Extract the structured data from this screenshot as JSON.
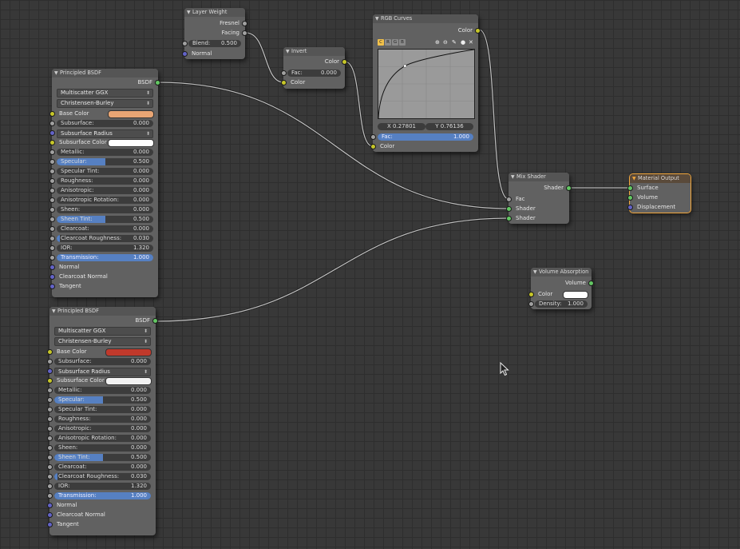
{
  "colors": {
    "shader_socket": "#63c763",
    "color_socket": "#c7c729",
    "value_socket": "#a1a1a1",
    "vector_socket": "#6363c7",
    "slider_fill": "#5680c2",
    "active_outline": "#f2a73d"
  },
  "layer_weight": {
    "title": "Layer Weight",
    "outputs": [
      "Fresnel",
      "Facing"
    ],
    "blend_label": "Blend:",
    "blend_value": "0.500",
    "normal_label": "Normal"
  },
  "invert": {
    "title": "Invert",
    "output": "Color",
    "fac_label": "Fac:",
    "fac_value": "0.000",
    "color_label": "Color"
  },
  "rgb_curves": {
    "title": "RGB Curves",
    "output": "Color",
    "channels": [
      "C",
      "R",
      "G",
      "B"
    ],
    "x_readout": "X 0.27801",
    "y_readout": "Y 0.76136",
    "fac_label": "Fac:",
    "fac_value": "1.000",
    "color_label": "Color",
    "curve_points": [
      [
        0,
        0
      ],
      [
        0.27801,
        0.76136
      ],
      [
        1,
        1
      ]
    ]
  },
  "mix_shader": {
    "title": "Mix Shader",
    "output": "Shader",
    "inputs": [
      "Fac",
      "Shader",
      "Shader"
    ]
  },
  "material_output": {
    "title": "Material Output",
    "inputs": [
      "Surface",
      "Volume",
      "Displacement"
    ]
  },
  "volume_absorption": {
    "title": "Volume Absorption",
    "output": "Volume",
    "color_label": "Color",
    "density_label": "Density:",
    "density_value": "1.000"
  },
  "principled_1": {
    "title": "Principled BSDF",
    "output": "BSDF",
    "distribution": "Multiscatter GGX",
    "subsurface_method": "Christensen-Burley",
    "base_color_label": "Base Color",
    "base_color": "#e8a574",
    "subsurface_label": "Subsurface:",
    "subsurface_value": "0.000",
    "subsurface_radius_label": "Subsurface Radius",
    "subsurface_color_label": "Subsurface Color",
    "subsurface_color": "#ffffff",
    "params": [
      {
        "label": "Metallic:",
        "value": "0.000",
        "fill": 0.0
      },
      {
        "label": "Specular:",
        "value": "0.500",
        "fill": 0.5
      },
      {
        "label": "Specular Tint:",
        "value": "0.000",
        "fill": 0.0
      },
      {
        "label": "Roughness:",
        "value": "0.000",
        "fill": 0.0
      },
      {
        "label": "Anisotropic:",
        "value": "0.000",
        "fill": 0.0
      },
      {
        "label": "Anisotropic Rotation:",
        "value": "0.000",
        "fill": 0.0
      },
      {
        "label": "Sheen:",
        "value": "0.000",
        "fill": 0.0
      },
      {
        "label": "Sheen Tint:",
        "value": "0.500",
        "fill": 0.5
      },
      {
        "label": "Clearcoat:",
        "value": "0.000",
        "fill": 0.0
      },
      {
        "label": "Clearcoat Roughness:",
        "value": "0.030",
        "fill": 0.03
      },
      {
        "label": "IOR:",
        "value": "1.320",
        "fill": 0.0
      },
      {
        "label": "Transmission:",
        "value": "1.000",
        "fill": 1.0
      }
    ],
    "vector_inputs": [
      "Normal",
      "Clearcoat Normal",
      "Tangent"
    ]
  },
  "principled_2": {
    "title": "Principled BSDF",
    "output": "BSDF",
    "distribution": "Multiscatter GGX",
    "subsurface_method": "Christensen-Burley",
    "base_color_label": "Base Color",
    "base_color": "#c0392b",
    "subsurface_label": "Subsurface:",
    "subsurface_value": "0.000",
    "subsurface_radius_label": "Subsurface Radius",
    "subsurface_color_label": "Subsurface Color",
    "subsurface_color": "#f2f2f2",
    "params": [
      {
        "label": "Metallic:",
        "value": "0.000",
        "fill": 0.0
      },
      {
        "label": "Specular:",
        "value": "0.500",
        "fill": 0.5
      },
      {
        "label": "Specular Tint:",
        "value": "0.000",
        "fill": 0.0
      },
      {
        "label": "Roughness:",
        "value": "0.000",
        "fill": 0.0
      },
      {
        "label": "Anisotropic:",
        "value": "0.000",
        "fill": 0.0
      },
      {
        "label": "Anisotropic Rotation:",
        "value": "0.000",
        "fill": 0.0
      },
      {
        "label": "Sheen:",
        "value": "0.000",
        "fill": 0.0
      },
      {
        "label": "Sheen Tint:",
        "value": "0.500",
        "fill": 0.5
      },
      {
        "label": "Clearcoat:",
        "value": "0.000",
        "fill": 0.0
      },
      {
        "label": "Clearcoat Roughness:",
        "value": "0.030",
        "fill": 0.03
      },
      {
        "label": "IOR:",
        "value": "1.320",
        "fill": 0.0
      },
      {
        "label": "Transmission:",
        "value": "1.000",
        "fill": 1.0
      }
    ],
    "vector_inputs": [
      "Normal",
      "Clearcoat Normal",
      "Tangent"
    ]
  }
}
